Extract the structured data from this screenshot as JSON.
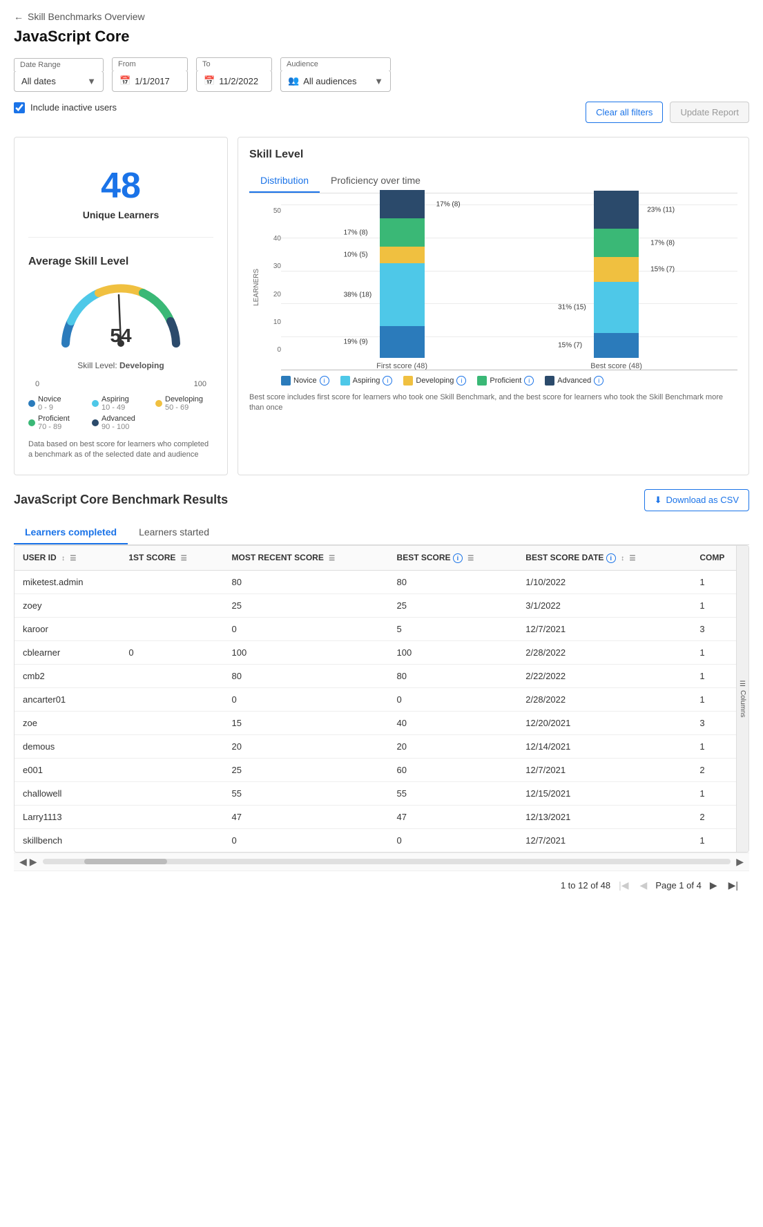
{
  "nav": {
    "back_label": "Skill Benchmarks Overview"
  },
  "page": {
    "title": "JavaScript Core"
  },
  "filters": {
    "date_range_label": "Date Range",
    "date_range_value": "All dates",
    "from_label": "From",
    "from_value": "1/1/2017",
    "to_label": "To",
    "to_value": "11/2/2022",
    "audience_label": "Audience",
    "audience_value": "All audiences",
    "include_inactive_label": "Include inactive users"
  },
  "actions": {
    "clear_filters_label": "Clear all filters",
    "update_report_label": "Update Report"
  },
  "left_panel": {
    "unique_learners_count": "48",
    "unique_learners_label": "Unique Learners",
    "avg_skill_title": "Average Skill Level",
    "score": "54",
    "skill_level_prefix": "Skill Level:",
    "skill_level_value": "Developing",
    "range_min": "0",
    "range_max": "100",
    "legend": [
      {
        "color": "#2b7bbb",
        "label": "Novice",
        "range": "0 - 9"
      },
      {
        "color": "#4ec8e8",
        "label": "Aspiring",
        "range": "10 - 49"
      },
      {
        "color": "#f0c040",
        "label": "Developing",
        "range": "50 - 69"
      },
      {
        "color": "#3ab876",
        "label": "Proficient",
        "range": "70 - 89"
      },
      {
        "color": "#2b4a6b",
        "label": "Advanced",
        "range": "90 - 100"
      }
    ],
    "data_note": "Data based on best score for learners who completed a benchmark as of the selected date and audience"
  },
  "skill_level_panel": {
    "title": "Skill Level",
    "tab_distribution": "Distribution",
    "tab_proficiency": "Proficiency over time",
    "y_axis_label": "LEARNERS",
    "y_ticks": [
      "50",
      "40",
      "30",
      "20",
      "10",
      "0"
    ],
    "bars": [
      {
        "label": "First score (48)",
        "segments": [
          {
            "color": "#2b7bbb",
            "pct": 19,
            "count": 9,
            "label": "19% (9)"
          },
          {
            "color": "#4ec8e8",
            "pct": 38,
            "count": 18,
            "label": "38% (18)"
          },
          {
            "color": "#f0c040",
            "pct": 10,
            "count": 5,
            "label": "10% (5)"
          },
          {
            "color": "#3ab876",
            "pct": 17,
            "count": 8,
            "label": "17% (8)"
          },
          {
            "color": "#2b4a6b",
            "pct": 17,
            "count": 8,
            "label": "17% (8)"
          }
        ]
      },
      {
        "label": "Best score (48)",
        "segments": [
          {
            "color": "#2b7bbb",
            "pct": 15,
            "count": 7,
            "label": "15% (7)"
          },
          {
            "color": "#4ec8e8",
            "pct": 31,
            "count": 15,
            "label": "31% (15)"
          },
          {
            "color": "#f0c040",
            "pct": 15,
            "count": 7,
            "label": "15% (7)"
          },
          {
            "color": "#3ab876",
            "pct": 17,
            "count": 8,
            "label": "17% (8)"
          },
          {
            "color": "#2b4a6b",
            "pct": 23,
            "count": 11,
            "label": "23% (11)"
          }
        ]
      }
    ],
    "legend": [
      {
        "color": "#2b7bbb",
        "label": "Novice"
      },
      {
        "color": "#4ec8e8",
        "label": "Aspiring"
      },
      {
        "color": "#f0c040",
        "label": "Developing"
      },
      {
        "color": "#3ab876",
        "label": "Proficient"
      },
      {
        "color": "#2b4a6b",
        "label": "Advanced"
      }
    ],
    "chart_note": "Best score includes first score for learners who took one Skill Benchmark, and the best score for learners who took the Skill Benchmark more than once"
  },
  "results": {
    "title": "JavaScript Core Benchmark Results",
    "download_label": "Download as CSV",
    "tab_completed": "Learners completed",
    "tab_started": "Learners started",
    "columns": [
      {
        "label": "USER ID",
        "sortable": true,
        "filterable": true
      },
      {
        "label": "1ST SCORE",
        "sortable": false,
        "filterable": true
      },
      {
        "label": "MOST RECENT SCORE",
        "sortable": false,
        "filterable": true
      },
      {
        "label": "BEST SCORE",
        "info": true,
        "sortable": false,
        "filterable": true
      },
      {
        "label": "BEST SCORE DATE",
        "info": true,
        "sortable": true,
        "filterable": true
      },
      {
        "label": "COMP",
        "sortable": false,
        "filterable": false
      }
    ],
    "rows": [
      {
        "user_id": "miketest.admin",
        "first_score": "",
        "most_recent": "80",
        "best_score": "80",
        "date": "1/10/2022",
        "comp": "1"
      },
      {
        "user_id": "zoey",
        "first_score": "",
        "most_recent": "25",
        "best_score": "25",
        "date": "3/1/2022",
        "comp": "1"
      },
      {
        "user_id": "karoor",
        "first_score": "",
        "most_recent": "0",
        "best_score": "5",
        "date": "12/7/2021",
        "comp": "3"
      },
      {
        "user_id": "cblearner",
        "first_score": "0",
        "most_recent": "100",
        "best_score": "100",
        "date": "2/28/2022",
        "comp": "1"
      },
      {
        "user_id": "cmb2",
        "first_score": "",
        "most_recent": "80",
        "best_score": "80",
        "date": "2/22/2022",
        "comp": "1"
      },
      {
        "user_id": "ancarter01",
        "first_score": "",
        "most_recent": "0",
        "best_score": "0",
        "date": "2/28/2022",
        "comp": "1"
      },
      {
        "user_id": "zoe",
        "first_score": "",
        "most_recent": "15",
        "best_score": "40",
        "date": "12/20/2021",
        "comp": "3"
      },
      {
        "user_id": "demous",
        "first_score": "",
        "most_recent": "20",
        "best_score": "20",
        "date": "12/14/2021",
        "comp": "1"
      },
      {
        "user_id": "e001",
        "first_score": "",
        "most_recent": "25",
        "best_score": "60",
        "date": "12/7/2021",
        "comp": "2"
      },
      {
        "user_id": "challowell",
        "first_score": "",
        "most_recent": "55",
        "best_score": "55",
        "date": "12/15/2021",
        "comp": "1"
      },
      {
        "user_id": "Larry1113",
        "first_score": "",
        "most_recent": "47",
        "best_score": "47",
        "date": "12/13/2021",
        "comp": "2"
      },
      {
        "user_id": "skillbench",
        "first_score": "",
        "most_recent": "0",
        "best_score": "0",
        "date": "12/7/2021",
        "comp": "1"
      }
    ],
    "pagination": {
      "summary": "1 to 12 of 48",
      "page_label": "Page 1 of 4"
    }
  }
}
